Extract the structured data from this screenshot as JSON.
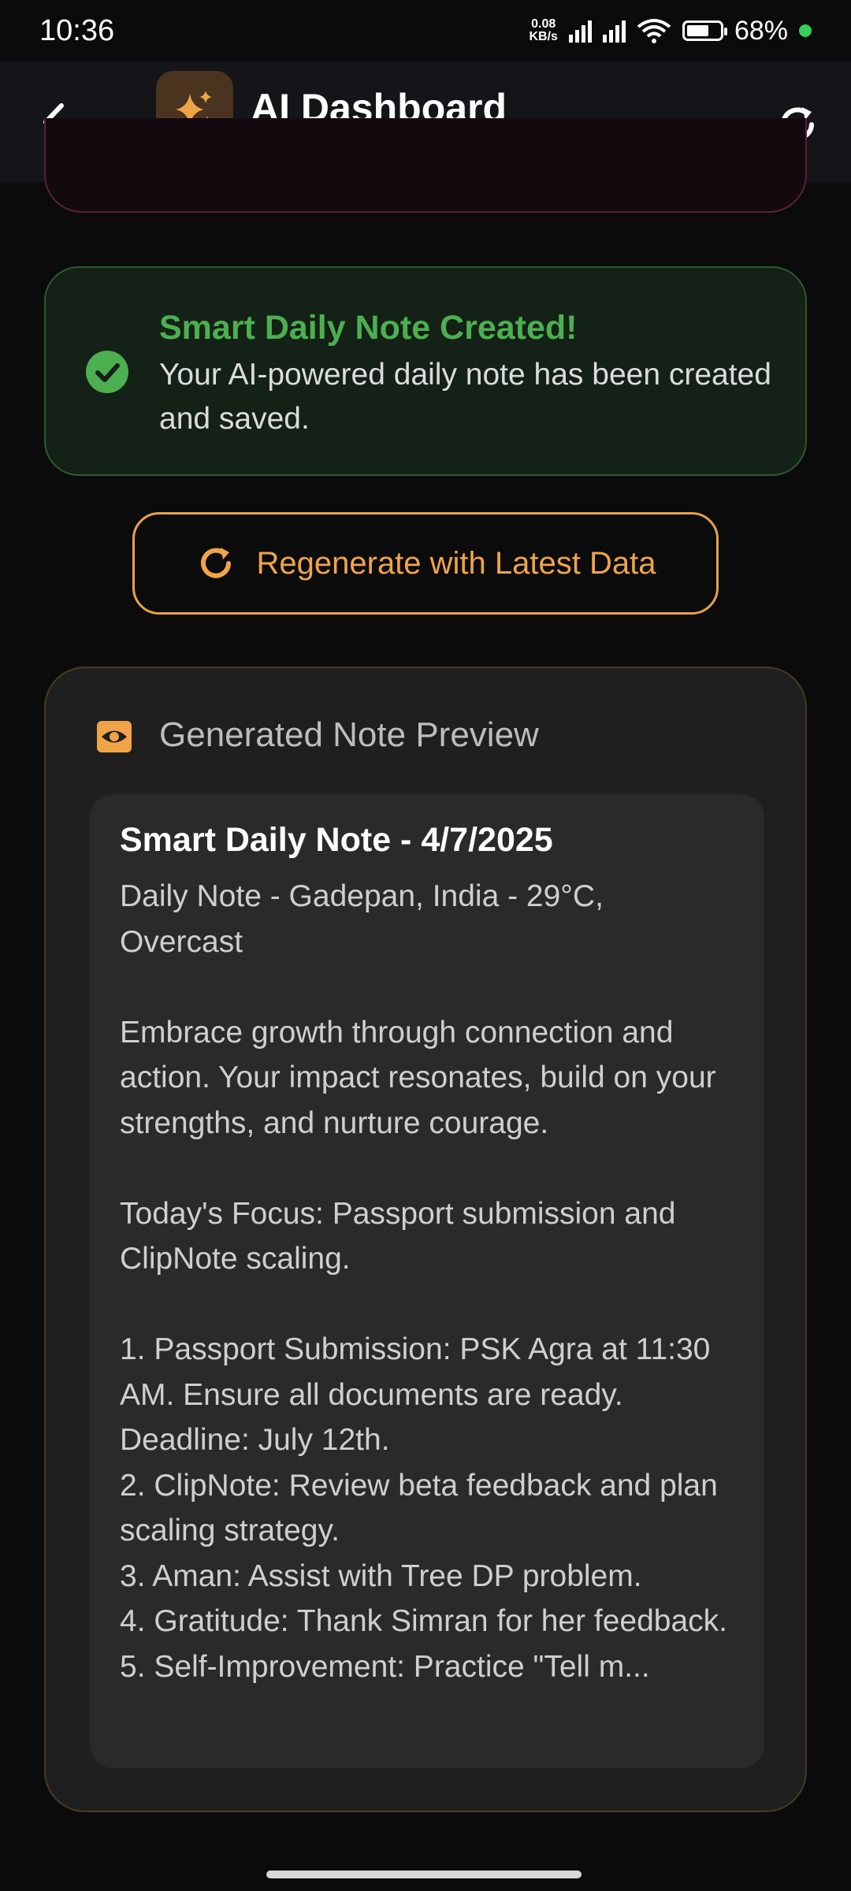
{
  "status_bar": {
    "time": "10:36",
    "net_speed_value": "0.08",
    "net_speed_unit": "KB/s",
    "battery": "68%",
    "battery_level": 0.68
  },
  "header": {
    "title": "AI Dashboard",
    "back_icon": "chevron-left-icon",
    "logo_icon": "sparkles-icon",
    "refresh_icon": "refresh-icon"
  },
  "success": {
    "title": "Smart Daily Note Created!",
    "message": "Your AI-powered daily note has been created and saved.",
    "color": "#4caf50"
  },
  "regenerate": {
    "label": "Regenerate with Latest Data",
    "color": "#f0a448"
  },
  "preview": {
    "title": "Generated Note Preview",
    "note_title": "Smart Daily Note - 4/7/2025",
    "note_body": "Daily Note - Gadepan, India - 29°C, Overcast\n\nEmbrace growth through connection and action. Your impact resonates, build on your strengths, and nurture courage.\n\nToday's Focus: Passport submission and ClipNote scaling.\n\n1. Passport Submission: PSK Agra at 11:30 AM. Ensure all documents are ready. Deadline: July 12th.\n2. ClipNote: Review beta feedback and plan scaling strategy.\n3. Aman: Assist with Tree DP problem.\n4. Gratitude: Thank Simran for her feedback.\n5. Self-Improvement: Practice \"Tell m..."
  }
}
